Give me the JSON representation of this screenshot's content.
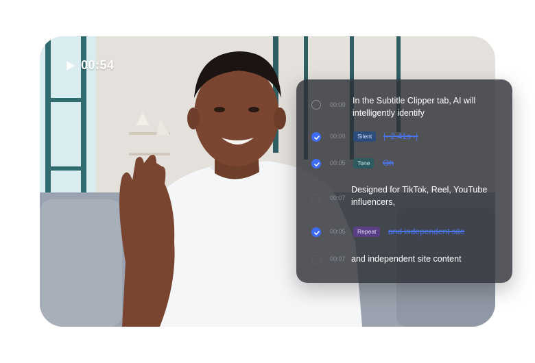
{
  "player": {
    "time": "00:54",
    "icon": "play-icon"
  },
  "colors": {
    "accent": "#3d6cf5",
    "panel": "#2c2e34",
    "strike": "#4c75f0"
  },
  "subtitles": [
    {
      "time": "00:00",
      "checked": false,
      "text": "In the Subtitle Clipper tab, AI will intelligently identify"
    },
    {
      "time": "00:00",
      "checked": true,
      "badge": "Silent",
      "struck": "|- 2.41s -|"
    },
    {
      "time": "00:05",
      "checked": true,
      "badge": "Tone",
      "struck": "Oh"
    },
    {
      "time": "00:07",
      "checked": false,
      "text": "Designed for TikTok, Reel, YouTube influencers,"
    },
    {
      "time": "00:05",
      "checked": true,
      "badge": "Repeat",
      "struck": "and independent site"
    },
    {
      "time": "00:07",
      "checked": false,
      "text": "and independent site content"
    }
  ]
}
